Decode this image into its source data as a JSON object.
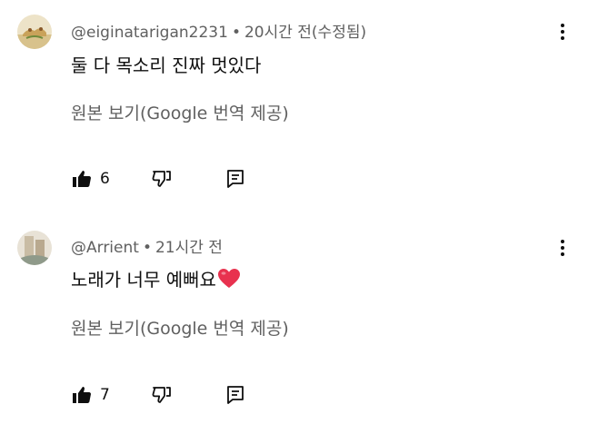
{
  "comments": [
    {
      "username": "@eiginatarigan2231",
      "separator": "•",
      "time": "20시간 전(수정됨)",
      "text": "둘 다 목소리 진짜 멋있다",
      "translate_label": "원본 보기(Google 번역 제공)",
      "like_count": "6",
      "avatar_colors": [
        "#e9dcc0",
        "#c9a25a",
        "#6f8a3c"
      ]
    },
    {
      "username": "@Arrient",
      "separator": "•",
      "time": "21시간 전",
      "text": "노래가 너무 예뻐요",
      "emoji": "heart-emoji",
      "translate_label": "원본 보기(Google 번역 제공)",
      "like_count": "7",
      "avatar_colors": [
        "#e8e2d6",
        "#b9a98f",
        "#8f9a8a"
      ]
    }
  ],
  "icons": {
    "like": "thumbs-up-icon",
    "dislike": "thumbs-down-icon",
    "reply": "comment-icon",
    "menu": "more-vertical-icon"
  },
  "colors": {
    "heart": "#e8324f",
    "secondary_text": "#606060",
    "primary_text": "#0f0f0f"
  }
}
